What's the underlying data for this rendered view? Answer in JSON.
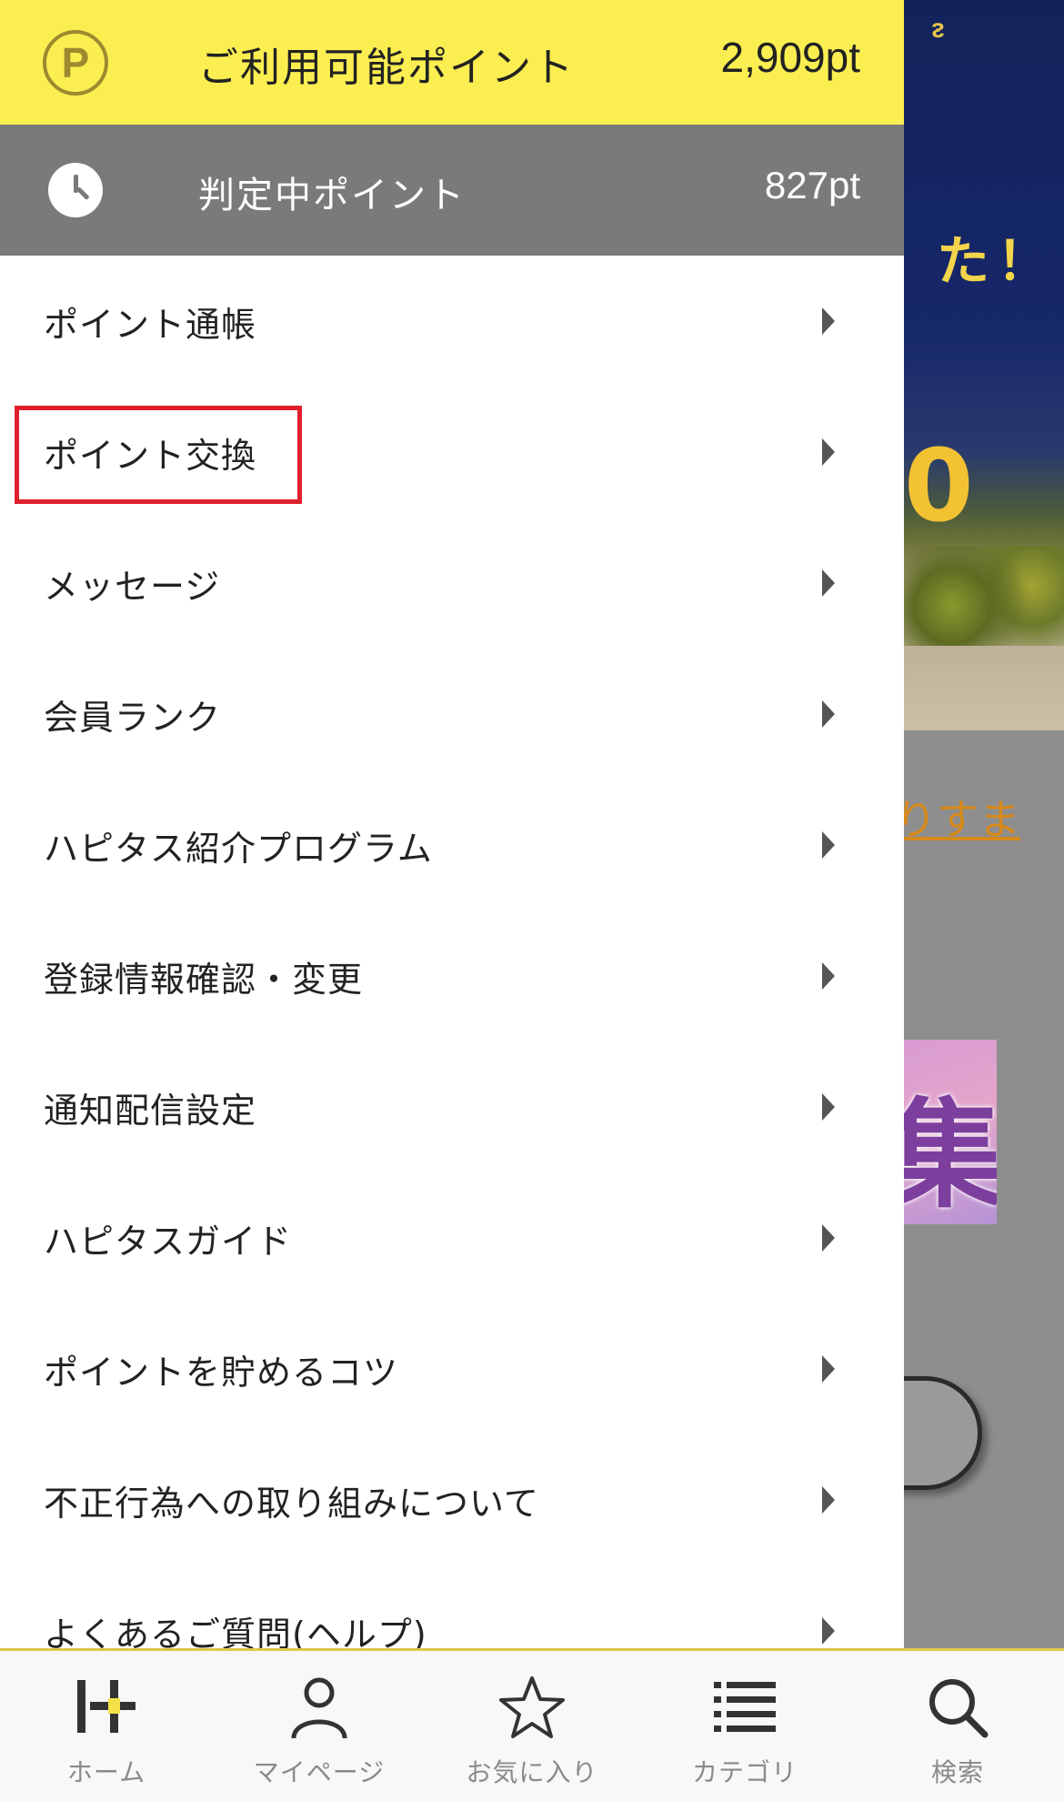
{
  "background": {
    "banner_top_text": "ᴤ",
    "banner_text_1": "た！",
    "banner_text_2": "0",
    "link_text": "りすま",
    "promo_char": "集"
  },
  "drawer": {
    "points": {
      "label": "ご利用可能ポイント",
      "value": "2,909pt",
      "icon": "P"
    },
    "pending": {
      "label": "判定中ポイント",
      "value": "827pt"
    },
    "menu_items": [
      {
        "label": "ポイント通帳"
      },
      {
        "label": "ポイント交換"
      },
      {
        "label": "メッセージ"
      },
      {
        "label": "会員ランク"
      },
      {
        "label": "ハピタス紹介プログラム"
      },
      {
        "label": "登録情報確認・変更"
      },
      {
        "label": "通知配信設定"
      },
      {
        "label": "ハピタスガイド"
      },
      {
        "label": "ポイントを貯めるコツ"
      },
      {
        "label": "不正行為への取り組みについて"
      },
      {
        "label": "よくあるご質問(ヘルプ)"
      }
    ],
    "highlighted_item": "ポイント交換",
    "highlight_color": "#e0202d"
  },
  "tabbar": {
    "tabs": [
      {
        "label": "ホーム",
        "icon": "home-logo-icon"
      },
      {
        "label": "マイページ",
        "icon": "person-icon"
      },
      {
        "label": "お気に入り",
        "icon": "star-icon"
      },
      {
        "label": "カテゴリ",
        "icon": "list-icon"
      },
      {
        "label": "検索",
        "icon": "search-icon"
      }
    ]
  },
  "colors": {
    "points_bar": "#fbee51",
    "pending_bar": "#7a7a7a",
    "accent_border": "#d8c94a"
  }
}
